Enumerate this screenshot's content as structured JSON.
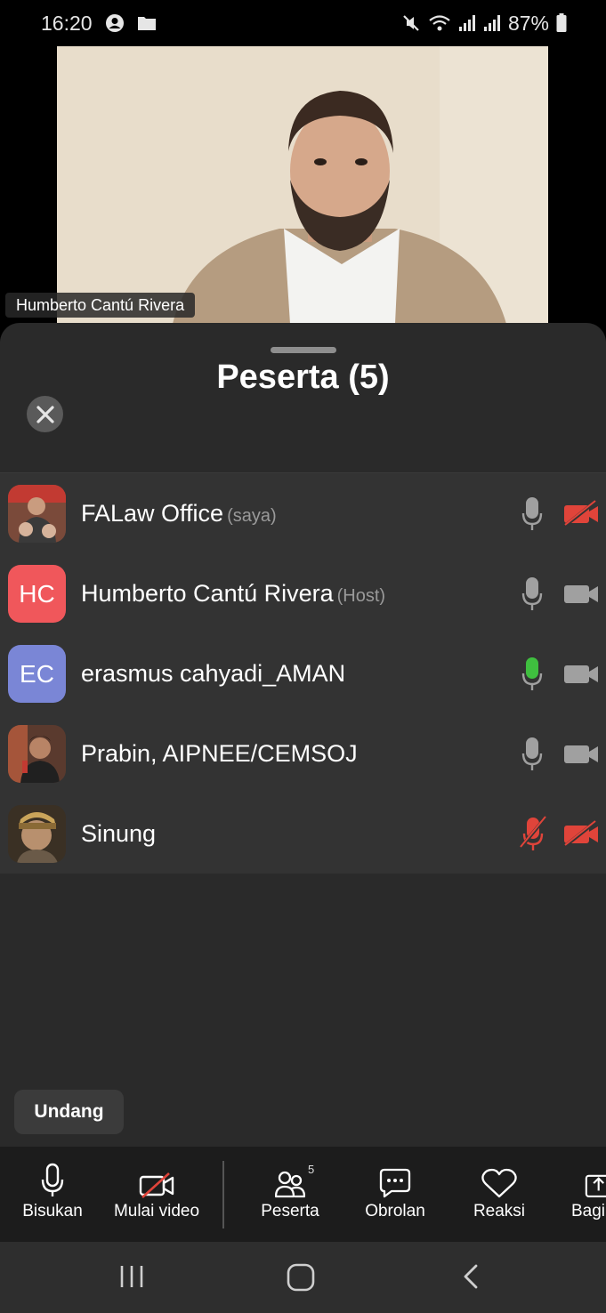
{
  "status_bar": {
    "time": "16:20",
    "battery": "87%",
    "icons": [
      "account-circle-icon",
      "folder-icon",
      "mute-icon",
      "wifi-icon",
      "signal-icon",
      "signal-icon",
      "battery-icon"
    ]
  },
  "video": {
    "speaker_name": "Humberto Cantú Rivera"
  },
  "sheet": {
    "title": "Peserta (5)",
    "close_icon": "close-icon"
  },
  "participants": [
    {
      "name": "FALaw Office",
      "role": "(saya)",
      "avatar_type": "photo",
      "mic": "off-grey",
      "video": "off"
    },
    {
      "name": "Humberto Cantú Rivera",
      "role": "(Host)",
      "avatar_type": "initials",
      "initials": "HC",
      "avatar_color": "#f0575b",
      "mic": "grey",
      "video": "on"
    },
    {
      "name": "erasmus cahyadi_AMAN",
      "role": "",
      "avatar_type": "initials",
      "initials": "EC",
      "avatar_color": "#7a86d6",
      "mic": "active",
      "video": "on"
    },
    {
      "name": "Prabin, AIPNEE/CEMSOJ",
      "role": "",
      "avatar_type": "photo",
      "mic": "grey",
      "video": "on"
    },
    {
      "name": "Sinung",
      "role": "",
      "avatar_type": "photo",
      "mic": "muted",
      "video": "off"
    }
  ],
  "invite_button": "Undang",
  "toolbar": {
    "items": [
      {
        "label": "Bisukan",
        "icon": "microphone-icon"
      },
      {
        "label": "Mulai video",
        "icon": "video-off-icon"
      },
      {
        "label": "Peserta",
        "icon": "participants-icon",
        "badge": "5"
      },
      {
        "label": "Obrolan",
        "icon": "chat-icon"
      },
      {
        "label": "Reaksi",
        "icon": "heart-icon"
      },
      {
        "label": "Bagi",
        "icon": "share-icon"
      }
    ]
  },
  "colors": {
    "active_mic": "#3fbf3f",
    "muted_red": "#e0443a",
    "icon_grey": "#a0a0a0"
  }
}
